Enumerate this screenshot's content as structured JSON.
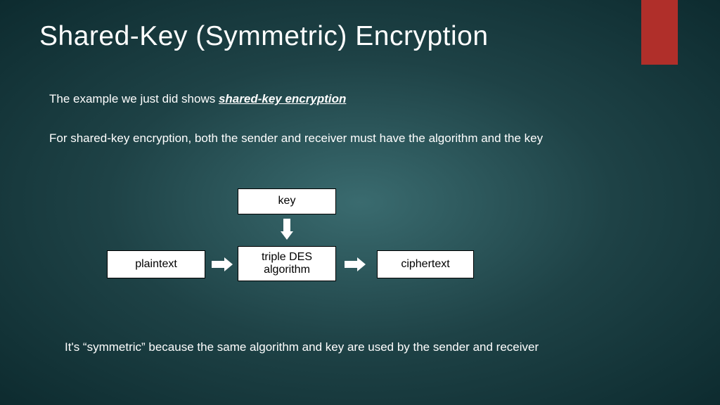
{
  "title": "Shared-Key (Symmetric) Encryption",
  "intro": {
    "prefix": "The example we just did shows ",
    "emphasis": "shared-key encryption"
  },
  "body": "For shared-key encryption, both the sender and receiver must have the algorithm and the key",
  "diagram": {
    "key": "key",
    "plaintext": "plaintext",
    "algorithm": "triple DES algorithm",
    "ciphertext": "ciphertext"
  },
  "footer": "It's “symmetric” because the same algorithm and key are used by the sender and receiver"
}
